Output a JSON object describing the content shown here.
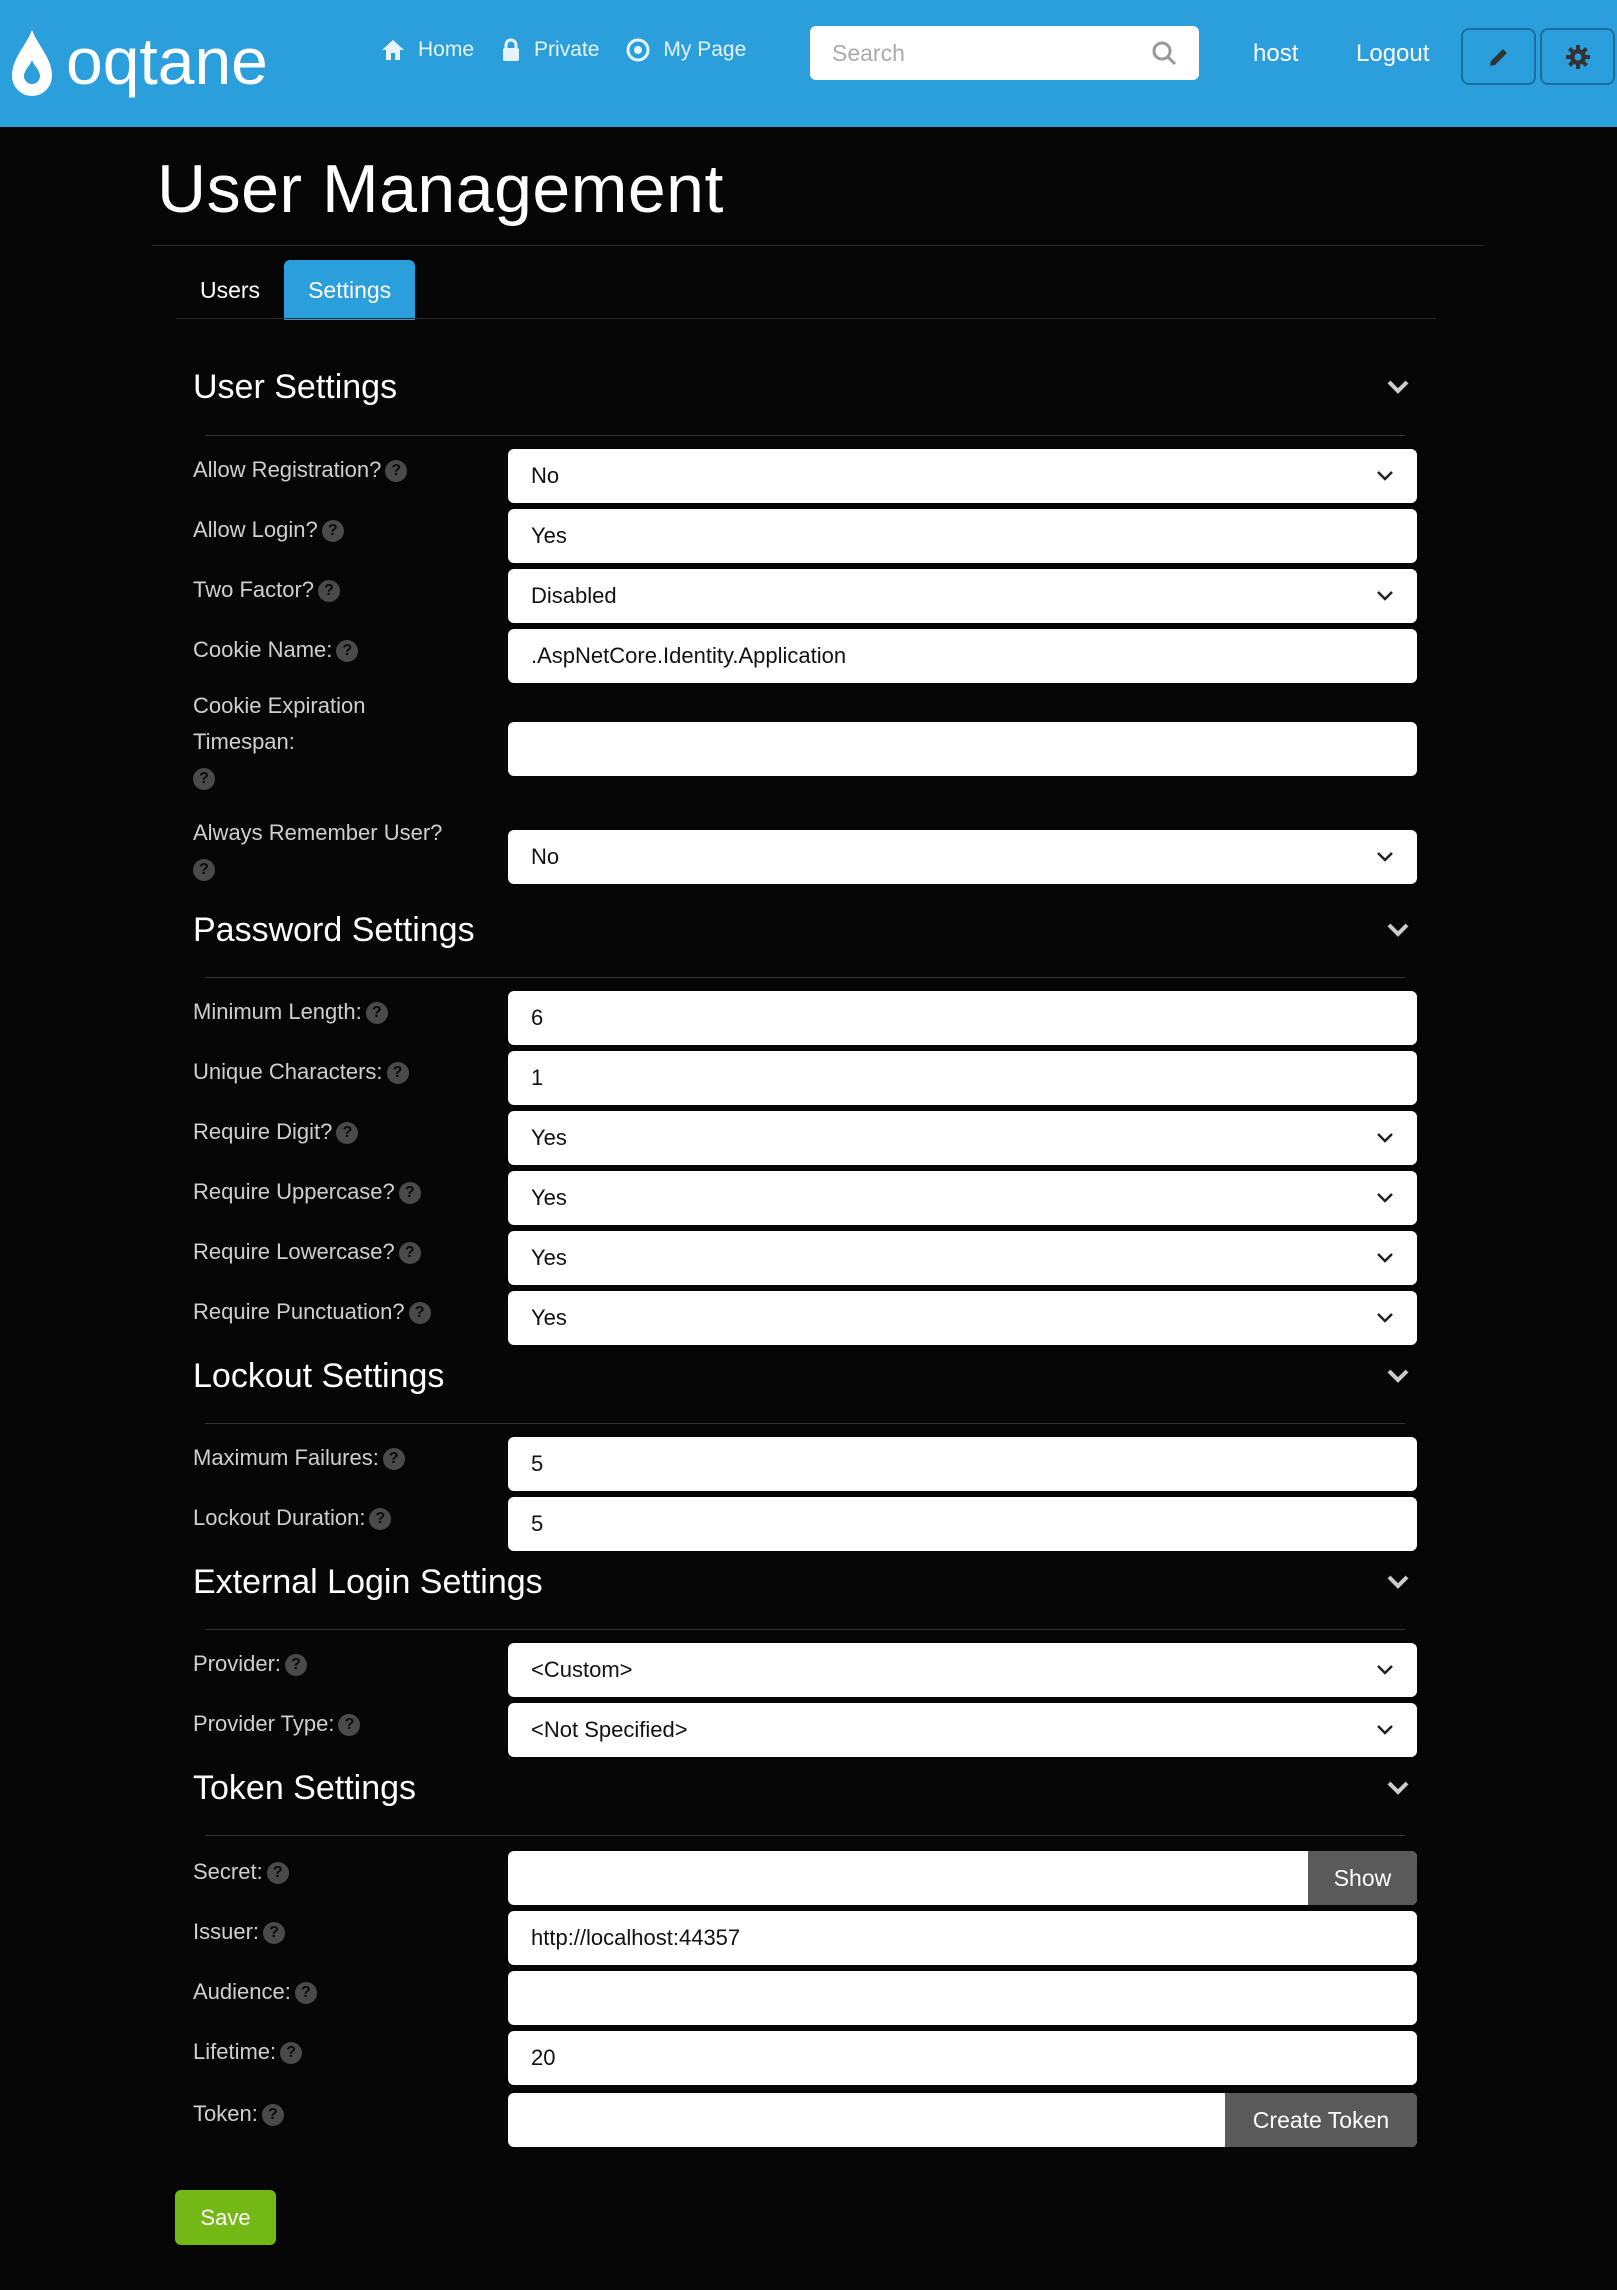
{
  "header": {
    "logo_text": "oqtane",
    "nav": [
      {
        "label": "Home",
        "icon": "home-icon"
      },
      {
        "label": "Private",
        "icon": "lock-icon"
      },
      {
        "label": "My Page",
        "icon": "target-icon"
      }
    ],
    "search_placeholder": "Search",
    "user": "host",
    "logout": "Logout",
    "brand_color": "#2b9fdb"
  },
  "page": {
    "title": "User Management",
    "tabs": [
      {
        "label": "Users",
        "active": false
      },
      {
        "label": "Settings",
        "active": true
      }
    ]
  },
  "sections": {
    "user": {
      "title": "User Settings",
      "fields": [
        {
          "label": "Allow Registration?",
          "value": "No"
        },
        {
          "label": "Allow Login?",
          "value": "Yes"
        },
        {
          "label": "Two Factor?",
          "value": "Disabled"
        },
        {
          "label": "Cookie Name:",
          "value": ".AspNetCore.Identity.Application"
        },
        {
          "label": "Cookie Expiration Timespan:",
          "value": ""
        },
        {
          "label": "Always Remember User?",
          "value": "No"
        }
      ]
    },
    "password": {
      "title": "Password Settings",
      "fields": [
        {
          "label": "Minimum Length:",
          "value": "6"
        },
        {
          "label": "Unique Characters:",
          "value": "1"
        },
        {
          "label": "Require Digit?",
          "value": "Yes"
        },
        {
          "label": "Require Uppercase?",
          "value": "Yes"
        },
        {
          "label": "Require Lowercase?",
          "value": "Yes"
        },
        {
          "label": "Require Punctuation?",
          "value": "Yes"
        }
      ]
    },
    "lockout": {
      "title": "Lockout Settings",
      "fields": [
        {
          "label": "Maximum Failures:",
          "value": "5"
        },
        {
          "label": "Lockout Duration:",
          "value": "5"
        }
      ]
    },
    "external": {
      "title": "External Login Settings",
      "fields": [
        {
          "label": "Provider:",
          "value": "<Custom>"
        },
        {
          "label": "Provider Type:",
          "value": "<Not Specified>"
        }
      ]
    },
    "token": {
      "title": "Token Settings",
      "fields": [
        {
          "label": "Secret:",
          "value": "",
          "button": "Show"
        },
        {
          "label": "Issuer:",
          "value": "http://localhost:44357"
        },
        {
          "label": "Audience:",
          "value": ""
        },
        {
          "label": "Lifetime:",
          "value": "20"
        },
        {
          "label": "Token:",
          "value": "",
          "button": "Create Token"
        }
      ]
    }
  },
  "help_glyph": "?",
  "save_label": "Save",
  "save_color": "#74b816"
}
